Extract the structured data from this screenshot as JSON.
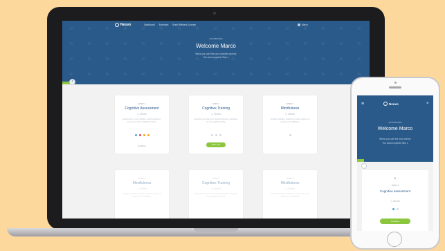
{
  "laptop": {
    "logo": "Neuvo",
    "nav": [
      "Dashboard",
      "Exercises",
      "Brain Wellness Journey"
    ],
    "user_name": "Marco",
    "hero": {
      "eyebrow": "DASHBOARD",
      "title": "Welcome Marco",
      "subtitle_line1": "Below you can find your complete journey",
      "subtitle_line2": "You must complete Step 1"
    },
    "cards": [
      {
        "step": "STEP 1",
        "title": "Cognitive Assessment",
        "time": "20 min",
        "description": "Assessment of your cognition covering attention, memory and other cognitive functions.",
        "link": "Continue"
      },
      {
        "step": "STEP 2",
        "title": "Cognitive Training",
        "time": "20 min",
        "description": "Exercises that train your cognitive functions, designed on your cognitive profile.",
        "button": "Start now"
      },
      {
        "step": "STEP 3",
        "title": "Mindfulness",
        "time": "20 min",
        "description": "Guided meditation sessions to reduce stress and improve your wellbeing."
      },
      {
        "step": "STEP 4",
        "title": "Mindfulness",
        "time": "20 min",
        "description": "Guided meditation sessions to reduce stress and improve your wellbeing."
      },
      {
        "step": "STEP 5",
        "title": "Cognitive Training",
        "time": "20 min",
        "description": "Exercises that train your cognitive functions, designed on your cognitive profile."
      },
      {
        "step": "STEP 6",
        "title": "Mindfulness",
        "time": "20 min",
        "description": "Guided meditation sessions to reduce stress and improve your wellbeing."
      }
    ],
    "assessment_dot_colors": [
      "#4aa3df",
      "#e9434b",
      "#f5a623",
      "#f5a623"
    ]
  },
  "phone": {
    "logo": "Neuvo",
    "hero": {
      "eyebrow": "DASHBOARD",
      "title": "Welcome Marco",
      "subtitle_line1": "Below you can find your journey",
      "subtitle_line2": "You must complete Step 1"
    },
    "card": {
      "number": "1",
      "step": "STEP 1",
      "title": "Cognitive assessment",
      "time": "20 min",
      "button": "Continue"
    },
    "dot_colors": [
      "#4aa3df",
      "#d3d9df"
    ]
  },
  "colors": {
    "brand_blue": "#2a5a8a",
    "accent_green": "#8cc63f",
    "background": "#fcd89c"
  }
}
